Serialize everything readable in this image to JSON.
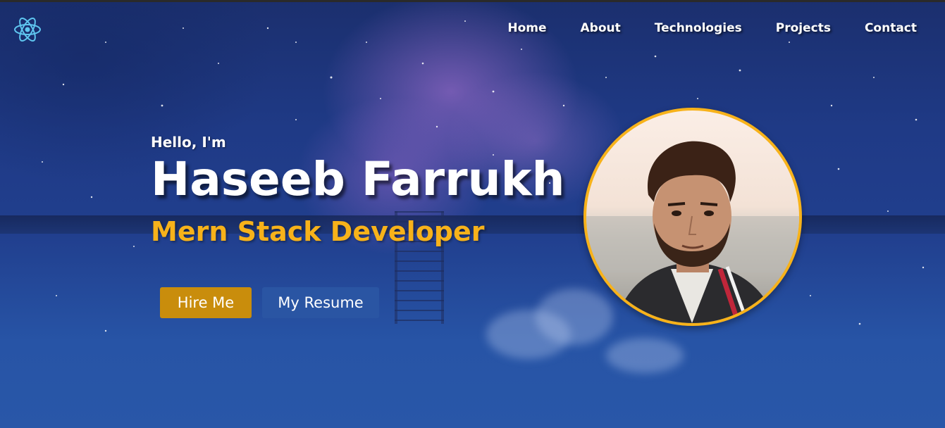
{
  "app": {
    "logo_icon": "react-atom-icon",
    "accent_color": "#f7b21a",
    "logo_color": "#5fc6f0"
  },
  "nav": {
    "items": [
      {
        "label": "Home"
      },
      {
        "label": "About"
      },
      {
        "label": "Technologies"
      },
      {
        "label": "Projects"
      },
      {
        "label": "Contact"
      }
    ]
  },
  "hero": {
    "greeting": "Hello, I'm",
    "name": "Haseeb Farrukh",
    "role": "Mern Stack Developer",
    "hire_button": "Hire Me",
    "resume_button": "My Resume"
  },
  "profile": {
    "photo_icon": "profile-photo"
  }
}
